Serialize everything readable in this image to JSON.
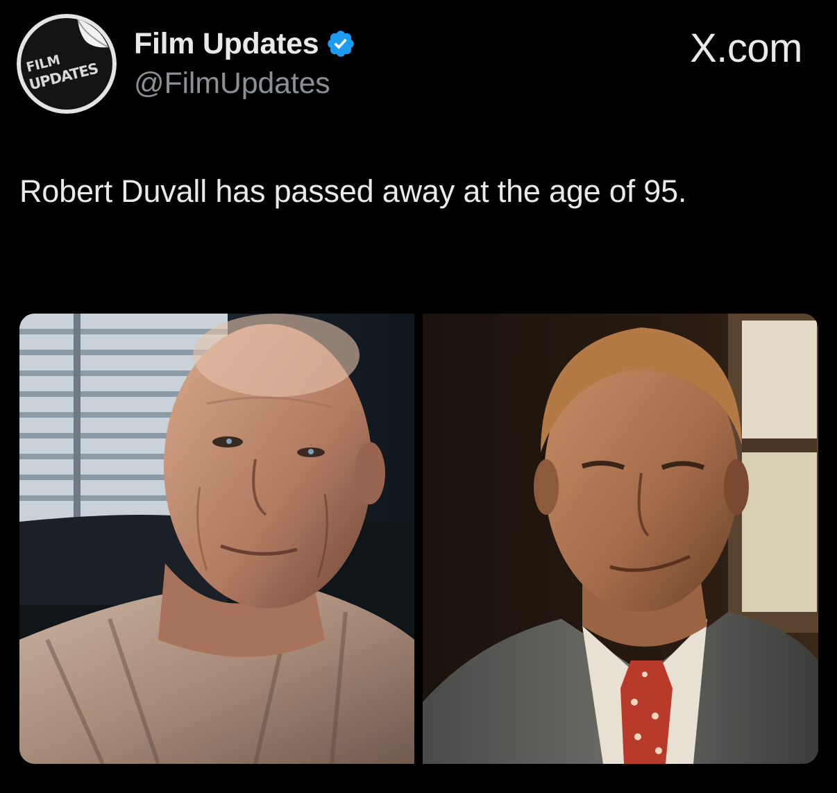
{
  "author": {
    "avatar_icon": "film-updates-logo-icon",
    "avatar_logo_text": [
      "FILM",
      "UPDATES"
    ],
    "display_name": "Film Updates",
    "verified_icon": "verified-badge-icon",
    "handle": "@FilmUpdates"
  },
  "watermark": "X.com",
  "tweet": {
    "text": "Robert Duvall has passed away at the age of 95."
  },
  "media": [
    {
      "name": "photo-elderly-man-plaid-shirt"
    },
    {
      "name": "photo-man-vest-red-tie"
    }
  ],
  "colors": {
    "background": "#000000",
    "text_primary": "#e7e9ea",
    "text_secondary": "#8b9096",
    "verified_blue": "#1d9bf0"
  }
}
